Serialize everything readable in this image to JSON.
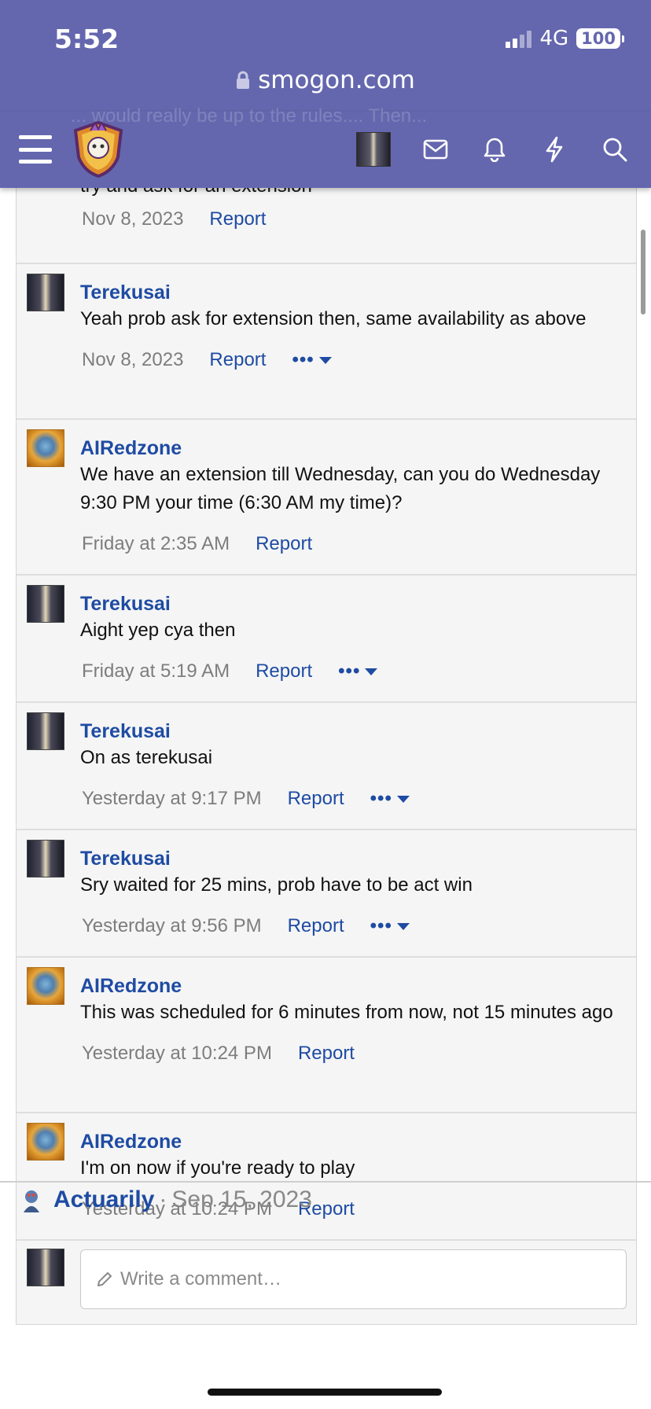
{
  "status_bar": {
    "time": "5:52",
    "network": "4G",
    "battery": "100"
  },
  "browser": {
    "url": "smogon.com"
  },
  "nav": {
    "ghost_text": "... would really be up to the rules.... Then..."
  },
  "comments": [
    {
      "partial_text": "try and ask for an extension",
      "date": "Nov 8, 2023",
      "report": "Report"
    },
    {
      "author": "Terekusai",
      "text": "Yeah prob ask for extension then, same availability as above",
      "date": "Nov 8, 2023",
      "report": "Report",
      "more": "•••"
    },
    {
      "author": "AIRedzone",
      "text": "We have an extension till Wednesday, can you do Wednesday 9:30 PM your time (6:30 AM my time)?",
      "date": "Friday at 2:35 AM",
      "report": "Report"
    },
    {
      "author": "Terekusai",
      "text": "Aight yep cya then",
      "date": "Friday at 5:19 AM",
      "report": "Report",
      "more": "•••"
    },
    {
      "author": "Terekusai",
      "text": "On as terekusai",
      "date": "Yesterday at 9:17 PM",
      "report": "Report",
      "more": "•••"
    },
    {
      "author": "Terekusai",
      "text": "Sry waited for 25 mins, prob have to be act win",
      "date": "Yesterday at 9:56 PM",
      "report": "Report",
      "more": "•••"
    },
    {
      "author": "AIRedzone",
      "text": "This was scheduled for 6 minutes from now, not 15 minutes ago",
      "date": "Yesterday at 10:24 PM",
      "report": "Report"
    },
    {
      "author": "AIRedzone",
      "text": "I'm on now if you're ready to play",
      "date": "Yesterday at 10:24 PM",
      "report": "Report"
    }
  ],
  "comment_box": {
    "placeholder": "Write a comment…"
  },
  "next_post": {
    "author": "Actuarily",
    "separator": "·",
    "date": "Sep 15, 2023"
  }
}
